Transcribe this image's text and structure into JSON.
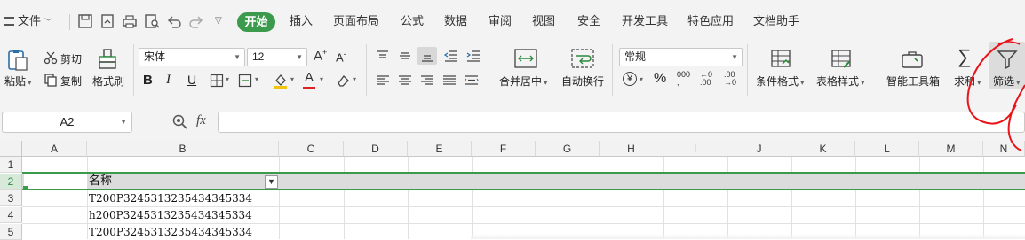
{
  "menubar": {
    "file_label": "文件",
    "tabs": [
      "开始",
      "插入",
      "页面布局",
      "公式",
      "数据",
      "审阅",
      "视图",
      "安全",
      "开发工具",
      "特色应用",
      "文档助手"
    ]
  },
  "ribbon": {
    "paste": "粘贴",
    "cut": "剪切",
    "copy": "复制",
    "format_painter": "格式刷",
    "font_name": "宋体",
    "font_size": "12",
    "merge_center": "合并居中",
    "wrap_text": "自动换行",
    "number_format": "常规",
    "conditional_format": "条件格式",
    "table_style": "表格样式",
    "smart_toolbox": "智能工具箱",
    "sum": "求和",
    "filter": "筛选"
  },
  "formula_bar": {
    "name_box": "A2",
    "fx": "fx",
    "value": ""
  },
  "sheet": {
    "columns": [
      "A",
      "B",
      "C",
      "D",
      "E",
      "F",
      "G",
      "H",
      "I",
      "J",
      "K",
      "L",
      "M",
      "N"
    ],
    "rows": [
      "1",
      "2",
      "3",
      "4",
      "5"
    ],
    "b2": "名称",
    "b3": "T200P3245313235434345334",
    "b4": "h200P3245313235434345334",
    "b5": "T200P3245313235434345334"
  },
  "colors": {
    "accent": "#3c9a4c",
    "annotation": "#e8141a"
  },
  "icons": [
    "save-icon",
    "print-icon",
    "print-preview-icon",
    "undo-icon",
    "redo-icon",
    "zoom-icon",
    "filter-icon",
    "sum-icon"
  ]
}
